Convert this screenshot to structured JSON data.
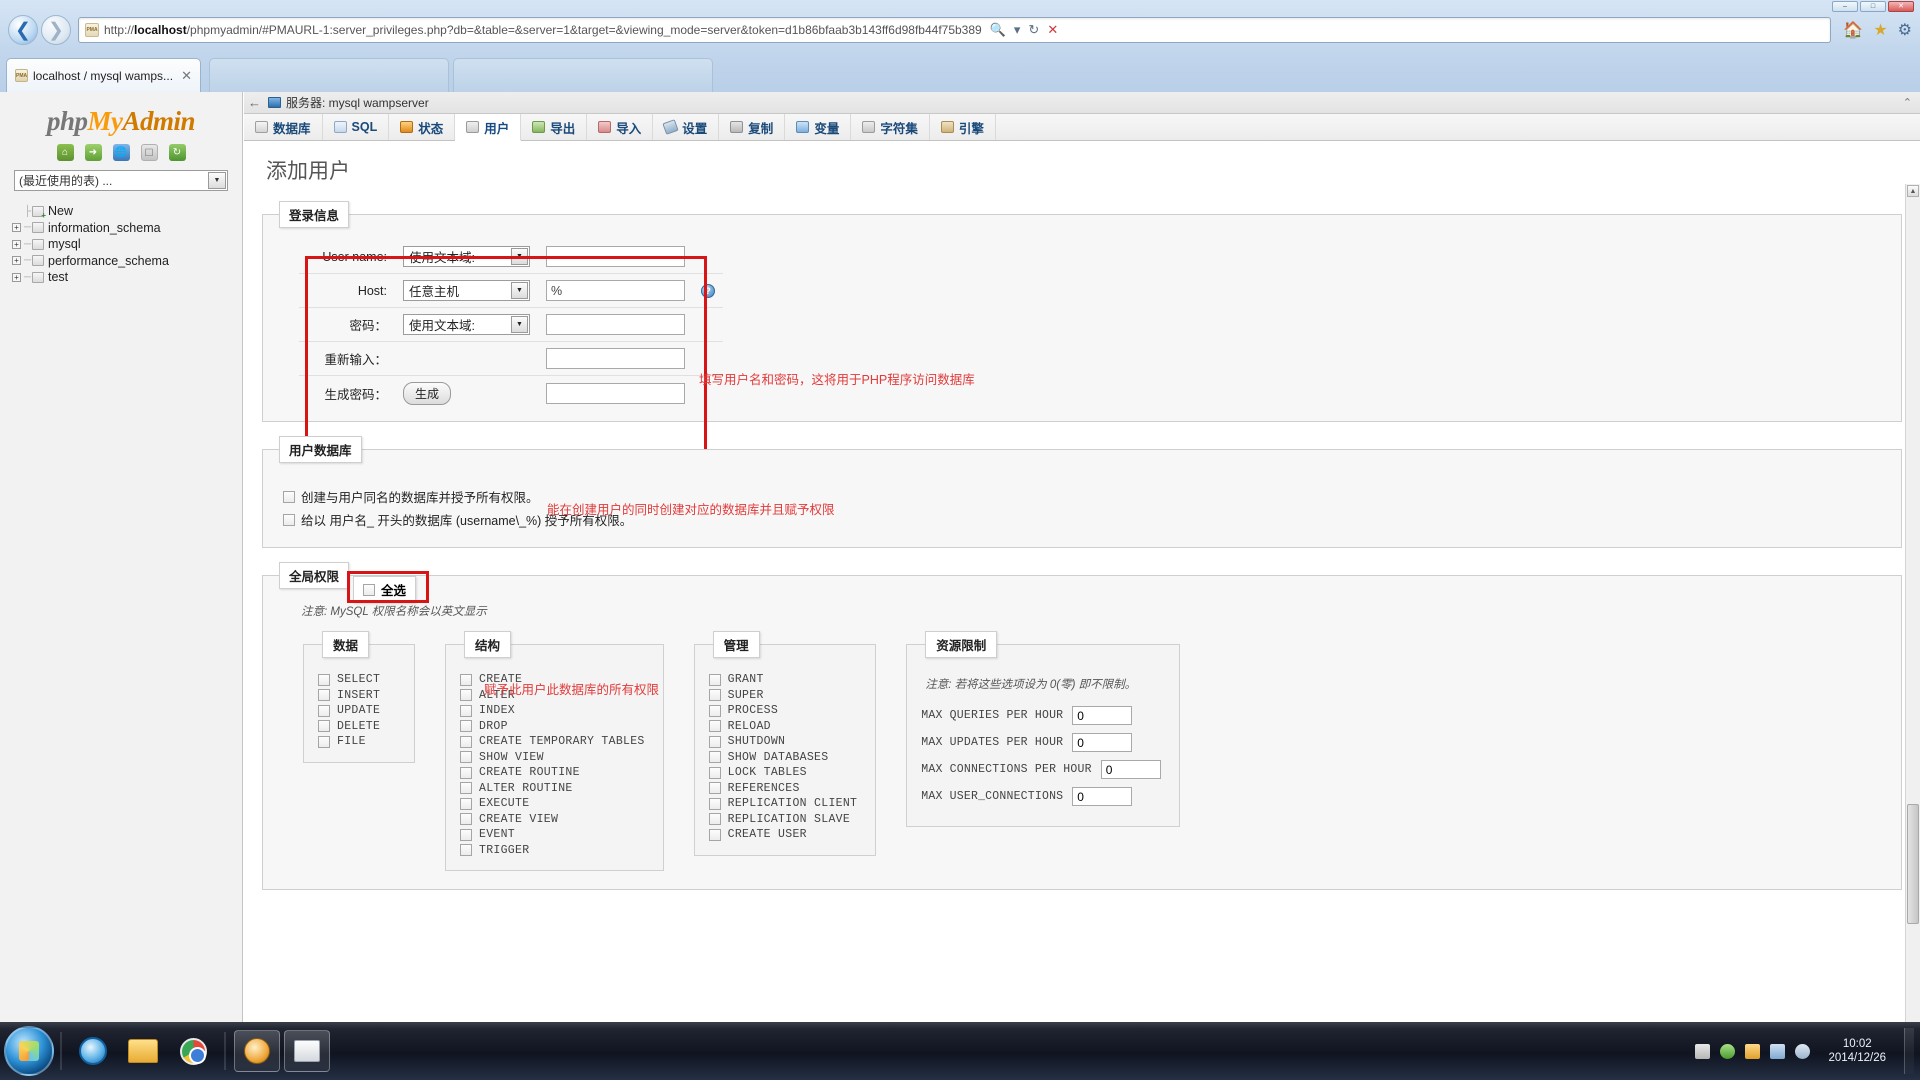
{
  "browser": {
    "window_controls": [
      "–",
      "□",
      "✕"
    ],
    "back_icon": "back-arrow-icon",
    "forward_icon": "forward-arrow-icon",
    "url": "http://localhost/phpmyadmin/#PMAURL-1:server_privileges.php?db=&table=&server=1&target=&viewing_mode=server&token=d1b86bfaab3b143ff6d98fb44f75b389",
    "url_host": "localhost",
    "favicon_text": "PMA",
    "search_icon": "search-icon",
    "refresh_icon": "refresh-icon",
    "stop_icon": "stop-icon",
    "home_icon": "home-icon",
    "favorites_icon": "star-icon",
    "tools_icon": "gear-icon",
    "tabs": [
      {
        "label": "localhost / mysql wamps...",
        "close": "✕",
        "active": true
      },
      {
        "label": "",
        "close": "✕",
        "active": false
      },
      {
        "label": "",
        "close": "✕",
        "active": false
      }
    ]
  },
  "navi": {
    "logo": {
      "php": "php",
      "my": "My",
      "admin": "Admin"
    },
    "icons": [
      "home-icon",
      "logout-icon",
      "globe-icon",
      "docs-icon",
      "reload-icon"
    ],
    "recent_select": "(最近使用的表) ...",
    "tree": [
      {
        "label": "New",
        "expandable": false,
        "new": true
      },
      {
        "label": "information_schema",
        "expandable": true,
        "new": false
      },
      {
        "label": "mysql",
        "expandable": true,
        "new": false
      },
      {
        "label": "performance_schema",
        "expandable": true,
        "new": false
      },
      {
        "label": "test",
        "expandable": true,
        "new": false
      }
    ]
  },
  "main": {
    "server_bar": {
      "back": "←",
      "label": "服务器: mysql wampserver",
      "collapse": "⌃"
    },
    "tabs": [
      {
        "label": "数据库",
        "icon": "database-icon",
        "active": false
      },
      {
        "label": "SQL",
        "icon": "sql-icon",
        "active": false
      },
      {
        "label": "状态",
        "icon": "status-icon",
        "active": false
      },
      {
        "label": "用户",
        "icon": "users-icon",
        "active": true
      },
      {
        "label": "导出",
        "icon": "export-icon",
        "active": false
      },
      {
        "label": "导入",
        "icon": "import-icon",
        "active": false
      },
      {
        "label": "设置",
        "icon": "settings-icon",
        "active": false
      },
      {
        "label": "复制",
        "icon": "replication-icon",
        "active": false
      },
      {
        "label": "变量",
        "icon": "variables-icon",
        "active": false
      },
      {
        "label": "字符集",
        "icon": "charset-icon",
        "active": false
      },
      {
        "label": "引擎",
        "icon": "engine-icon",
        "active": false
      }
    ],
    "page_title": "添加用户"
  },
  "login_info": {
    "legend": "登录信息",
    "rows": [
      {
        "label": "User name:",
        "select": "使用文本域:",
        "value": "",
        "help": false
      },
      {
        "label": "Host:",
        "select": "任意主机",
        "value": "%",
        "help": true
      },
      {
        "label": "密码：",
        "select": "使用文本域:",
        "value": "",
        "help": false
      },
      {
        "label": "重新输入：",
        "select": null,
        "value": "",
        "help": false
      },
      {
        "label": "生成密码：",
        "button": "生成",
        "value": "",
        "help": false
      }
    ],
    "annotation": "填写用户名和密码，这将用于PHP程序访问数据库"
  },
  "user_db": {
    "legend": "用户数据库",
    "checkboxes": [
      {
        "label": "创建与用户同名的数据库并授予所有权限。",
        "checked": false
      },
      {
        "label": "给以 用户名_ 开头的数据库 (username\\_%) 授予所有权限。",
        "checked": false
      }
    ],
    "annotation": "能在创建用户的同时创建对应的数据库并且赋予权限"
  },
  "global_priv": {
    "legend": "全局权限",
    "check_all": {
      "label": "全选",
      "checked": false
    },
    "annotation": "赋予此用户此数据库的所有权限",
    "note": "注意: MySQL 权限名称会以英文显示",
    "columns": [
      {
        "legend": "数据",
        "items": [
          "SELECT",
          "INSERT",
          "UPDATE",
          "DELETE",
          "FILE"
        ]
      },
      {
        "legend": "结构",
        "items": [
          "CREATE",
          "ALTER",
          "INDEX",
          "DROP",
          "CREATE TEMPORARY TABLES",
          "SHOW VIEW",
          "CREATE ROUTINE",
          "ALTER ROUTINE",
          "EXECUTE",
          "CREATE VIEW",
          "EVENT",
          "TRIGGER"
        ]
      },
      {
        "legend": "管理",
        "items": [
          "GRANT",
          "SUPER",
          "PROCESS",
          "RELOAD",
          "SHUTDOWN",
          "SHOW DATABASES",
          "LOCK TABLES",
          "REFERENCES",
          "REPLICATION CLIENT",
          "REPLICATION SLAVE",
          "CREATE USER"
        ]
      }
    ],
    "resource_limits": {
      "legend": "资源限制",
      "note": "注意: 若将这些选项设为 0(零) 即不限制。",
      "fields": [
        {
          "label": "MAX QUERIES PER HOUR",
          "value": "0"
        },
        {
          "label": "MAX UPDATES PER HOUR",
          "value": "0"
        },
        {
          "label": "MAX CONNECTIONS PER HOUR",
          "value": "0"
        },
        {
          "label": "MAX USER_CONNECTIONS",
          "value": "0"
        }
      ]
    }
  },
  "taskbar": {
    "start": "start-orb",
    "items": [
      "internet-explorer-icon",
      "file-explorer-icon",
      "chrome-icon",
      "wamp-icon",
      "window-icon"
    ],
    "tray": [
      "tray-icon-a",
      "tray-icon-b",
      "tray-icon-c",
      "tray-icon-d",
      "tray-icon-e"
    ],
    "clock_time": "10:02",
    "clock_date": "2014/12/26"
  },
  "colors": {
    "highlight_red": "#d81414",
    "annotation_red": "#e23a3a",
    "accent_blue": "#1a4a7a",
    "logo_orange": "#f89c0e"
  }
}
